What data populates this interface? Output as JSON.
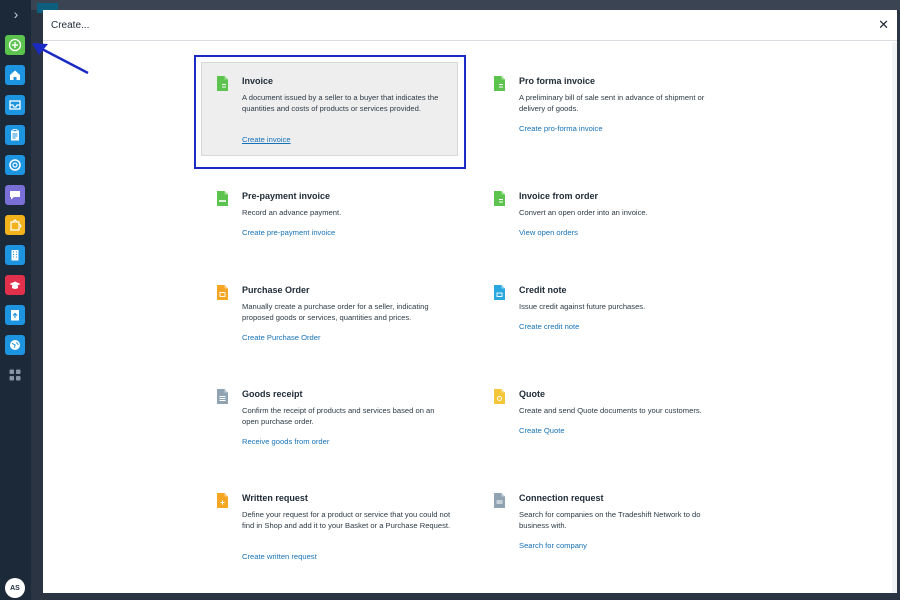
{
  "sidebar": {
    "toggle_glyph": "›",
    "items": [
      {
        "icon": "plus-icon",
        "color": "#5cc34f"
      },
      {
        "icon": "home-icon",
        "color": "#1d94e0"
      },
      {
        "icon": "inbox-icon",
        "color": "#1d94e0"
      },
      {
        "icon": "clipboard-icon",
        "color": "#1d94e0"
      },
      {
        "icon": "lifebuoy-icon",
        "color": "#1d94e0"
      },
      {
        "icon": "chat-icon",
        "color": "#7a6fd6"
      },
      {
        "icon": "puzzle-icon",
        "color": "#f2b21c"
      },
      {
        "icon": "building-icon",
        "color": "#1d94e0"
      },
      {
        "icon": "graduation-icon",
        "color": "#e0304b"
      },
      {
        "icon": "upload-icon",
        "color": "#1d94e0"
      },
      {
        "icon": "globe-icon",
        "color": "#1d94e0"
      },
      {
        "icon": "apps-grid-icon",
        "color": "#8795a5"
      }
    ],
    "avatar_initials": "AS"
  },
  "modal": {
    "title": "Create...",
    "close_glyph": "✕"
  },
  "cards": [
    {
      "title": "Invoice",
      "desc": "A document issued by a seller to a buyer that indicates the quantities and costs of products or services provided.",
      "link": "Create invoice",
      "icon_color": "#5cc34f"
    },
    {
      "title": "Pro forma invoice",
      "desc": "A preliminary bill of sale sent in advance of shipment or delivery of goods.",
      "link": "Create pro-forma invoice",
      "icon_color": "#5cc34f"
    },
    {
      "title": "Pre-payment invoice",
      "desc": "Record an advance payment.",
      "link": "Create pre-payment invoice",
      "icon_color": "#5cc34f"
    },
    {
      "title": "Invoice from order",
      "desc": "Convert an open order into an invoice.",
      "link": "View open orders",
      "icon_color": "#5cc34f"
    },
    {
      "title": "Purchase Order",
      "desc": "Manually create a purchase order for a seller, indicating proposed goods or services, quantities and prices.",
      "link": "Create Purchase Order",
      "icon_color": "#f5a623"
    },
    {
      "title": "Credit note",
      "desc": "Issue credit against future purchases.",
      "link": "Create credit note",
      "icon_color": "#29a8e0"
    },
    {
      "title": "Goods receipt",
      "desc": "Confirm the receipt of products and services based on an open purchase order.",
      "link": "Receive goods from order",
      "icon_color": "#8fa3b3"
    },
    {
      "title": "Quote",
      "desc": "Create and send Quote documents to your customers.",
      "link": "Create Quote",
      "icon_color": "#f5c53a"
    },
    {
      "title": "Written request",
      "desc": "Define your request for a product or service that you could not find in Shop and add it to your Basket or a Purchase Request.",
      "link": "Create written request",
      "icon_color": "#f5a623"
    },
    {
      "title": "Connection request",
      "desc": "Search for companies on the Tradeshift Network to do business with.",
      "link": "Search for company",
      "icon_color": "#8fa3b3"
    }
  ]
}
